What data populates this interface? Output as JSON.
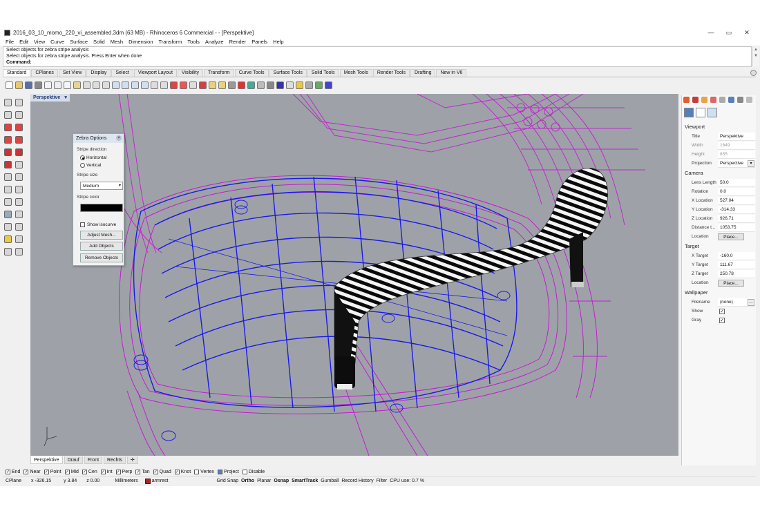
{
  "window": {
    "title": "2016_03_10_momo_220_vi_assembled.3dm (63 MB) - Rhinoceros 6 Commercial - - [Perspektive]"
  },
  "menu": [
    "File",
    "Edit",
    "View",
    "Curve",
    "Surface",
    "Solid",
    "Mesh",
    "Dimension",
    "Transform",
    "Tools",
    "Analyze",
    "Render",
    "Panels",
    "Help"
  ],
  "command": {
    "history1": "Select objects for zebra stripe analysis",
    "history2": "Select objects for zebra stripe analysis. Press Enter when done",
    "prompt": "Command:"
  },
  "tabs": [
    "Standard",
    "CPlanes",
    "Set View",
    "Display",
    "Select",
    "Viewport Layout",
    "Visibility",
    "Transform",
    "Curve Tools",
    "Surface Tools",
    "Solid Tools",
    "Mesh Tools",
    "Render Tools",
    "Drafting",
    "New in V6"
  ],
  "viewport": {
    "title": "Perspektive"
  },
  "zebra": {
    "title": "Zebra Options",
    "stripe_direction": "Stripe direction",
    "horizontal": "Horizontal",
    "vertical": "Vertical",
    "stripe_size": "Stripe size",
    "size_value": "Medium",
    "stripe_color": "Stripe color",
    "color": "#000000",
    "show_isocurve": "Show isocurve",
    "adjust_mesh": "Adjust Mesh...",
    "add_objects": "Add Objects",
    "remove_objects": "Remove Objects"
  },
  "viewport_tabs": [
    "Perspektive",
    "Drauf",
    "Front",
    "Rechts"
  ],
  "osnaps": [
    {
      "label": "End",
      "checked": true
    },
    {
      "label": "Near",
      "checked": true
    },
    {
      "label": "Point",
      "checked": true
    },
    {
      "label": "Mid",
      "checked": true
    },
    {
      "label": "Cen",
      "checked": true
    },
    {
      "label": "Int",
      "checked": true
    },
    {
      "label": "Perp",
      "checked": true
    },
    {
      "label": "Tan",
      "checked": true
    },
    {
      "label": "Quad",
      "checked": true
    },
    {
      "label": "Knot",
      "checked": true
    },
    {
      "label": "Vertex",
      "checked": false
    },
    {
      "label": "Project",
      "checked": true
    },
    {
      "label": "Disable",
      "checked": false
    }
  ],
  "status": {
    "cplane": "CPlane",
    "x": "x -326.15",
    "y": "y 3.84",
    "z": "z 0.00",
    "units": "Millimeters",
    "layer": "armrest",
    "layer_color": "#b22222",
    "grid_snap": "Grid Snap",
    "ortho": "Ortho",
    "planar": "Planar",
    "osnap": "Osnap",
    "smarttrack": "SmartTrack",
    "gumball": "Gumball",
    "record_history": "Record History",
    "filter": "Filter",
    "cpu": "CPU use: 0.7 %"
  },
  "panel": {
    "viewport_section": "Viewport",
    "title_label": "Title",
    "title_value": "Perspektive",
    "width_label": "Width",
    "width_value": "1649",
    "height_label": "Height",
    "height_value": "855",
    "projection_label": "Projection",
    "projection_value": "Perspective",
    "camera_section": "Camera",
    "lens_label": "Lens Length",
    "lens_value": "50.0",
    "rotation_label": "Rotation",
    "rotation_value": "0.0",
    "xloc_label": "X Location",
    "xloc_value": "527.04",
    "yloc_label": "Y Location",
    "yloc_value": "-314.33",
    "zloc_label": "Z Location",
    "zloc_value": "926.71",
    "dist_label": "Distance t...",
    "dist_value": "1053.75",
    "loc_label": "Location",
    "place": "Place...",
    "target_section": "Target",
    "xt_label": "X Target",
    "xt_value": "-160.0",
    "yt_label": "Y Target",
    "yt_value": "111.67",
    "zt_label": "Z Target",
    "zt_value": "250.78",
    "tloc_label": "Location",
    "wallpaper_section": "Wallpaper",
    "filename_label": "Filename",
    "filename_value": "(none)",
    "show_label": "Show",
    "gray_label": "Gray"
  }
}
